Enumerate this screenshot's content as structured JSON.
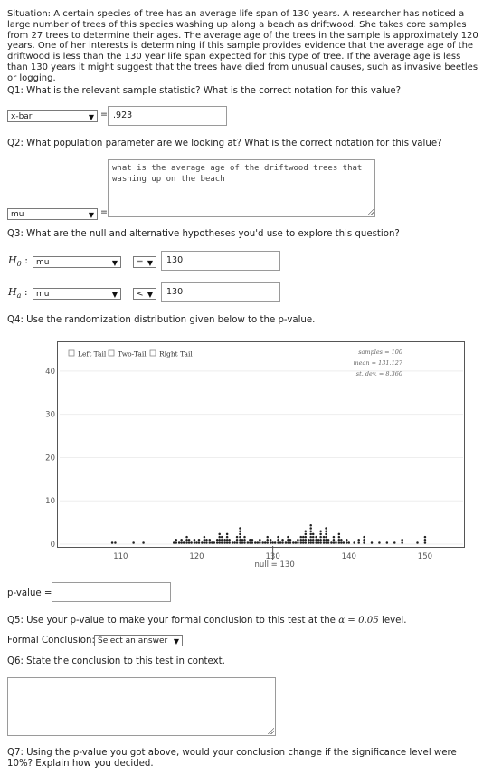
{
  "situation": "Situation: A certain species of tree has an average life span of 130 years. A researcher has noticed a large number of trees of this species washing up along a beach as driftwood. She takes core samples from 27 trees to determine their ages. The average age of the trees in the sample is approximately 120 years. One of her interests is determining if this sample provides evidence that the average age of the driftwood is less than the 130 year life span expected for this type of tree. If the average age is less than 130 years it might suggest that the trees have died from unusual causes, such as invasive beetles or logging.",
  "q1": {
    "text": "Q1: What is the relevant sample statistic? What is the correct notation for this value?",
    "notation": "x-bar",
    "equals": "=",
    "value": ".923"
  },
  "q2": {
    "text": "Q2: What population parameter are we looking at? What is the correct notation for this value?",
    "description": "what is the average age of the driftwood trees that washing up on the beach",
    "notation": "mu",
    "equals": "="
  },
  "q3": {
    "text": "Q3: What are the null and alternative hypotheses you'd use to explore this question?",
    "h0_label": "H",
    "h0_sub": "0",
    "ha_label": "H",
    "ha_sub": "a",
    "colon": ":",
    "h0_param": "mu",
    "h0_op": "=",
    "h0_value": "130",
    "ha_param": "mu",
    "ha_op": "<",
    "ha_value": "130"
  },
  "q4": {
    "text": "Q4: Use the randomization distribution given below to the p-value.",
    "pvalue_label": "p-value ="
  },
  "q5": {
    "text_pre": "Q5: Use your p-value to make your formal conclusion to this test at the ",
    "alpha": "α = 0.05",
    "text_post": " level.",
    "conclusion_label": "Formal Conclusion:",
    "conclusion_select": "Select an answer"
  },
  "q6": {
    "text": "Q6: State the conclusion to this test in context."
  },
  "q7": {
    "text": "Q7: Using the p-value you got above, would your conclusion change if the significance level were 10%? Explain how you decided."
  },
  "chart_data": {
    "type": "scatter",
    "checkboxes": [
      "Left Tail",
      "Two-Tail",
      "Right Tail"
    ],
    "stats": [
      "samples = 100",
      "mean = 131.127",
      "st. dev. = 8.360"
    ],
    "xticks": [
      "110",
      "120",
      "130",
      "140",
      "150"
    ],
    "yticks": [
      "0",
      "10",
      "20",
      "30",
      "40"
    ],
    "null_label": "null = 130",
    "xlim": [
      102,
      155
    ],
    "ylim": [
      0,
      45
    ],
    "x": [
      108.9,
      109.3,
      111.7,
      113.0,
      117.0,
      117.3,
      117.7,
      118.0,
      118.3,
      118.7,
      119.0,
      119.3,
      119.7,
      120.0,
      120.3,
      120.7,
      121.0,
      121.3,
      121.7,
      122.0,
      122.3,
      122.7,
      123.0,
      123.3,
      123.7,
      124.0,
      124.3,
      124.7,
      125.0,
      125.3,
      125.7,
      126.0,
      126.3,
      126.7,
      127.0,
      127.3,
      127.7,
      128.0,
      128.3,
      128.7,
      129.0,
      129.3,
      129.7,
      130.0,
      130.3,
      130.7,
      131.0,
      131.3,
      131.7,
      132.0,
      132.3,
      132.7,
      133.0,
      133.3,
      133.7,
      134.0,
      134.3,
      134.7,
      135.0,
      135.3,
      135.7,
      136.0,
      136.3,
      136.7,
      137.0,
      137.3,
      137.7,
      138.0,
      138.3,
      138.7,
      139.0,
      139.3,
      139.7,
      140.0,
      140.7,
      141.3,
      142.0,
      143.0,
      144.0,
      145.0,
      146.0,
      147.0,
      149.0,
      150.0
    ],
    "y": [
      1,
      1,
      1,
      1,
      1,
      2,
      1,
      2,
      1,
      3,
      2,
      1,
      2,
      1,
      2,
      1,
      3,
      2,
      2,
      1,
      1,
      2,
      4,
      3,
      2,
      4,
      2,
      1,
      1,
      3,
      6,
      2,
      3,
      1,
      2,
      2,
      1,
      1,
      2,
      1,
      1,
      3,
      2,
      1,
      1,
      3,
      1,
      2,
      1,
      3,
      2,
      1,
      1,
      2,
      3,
      3,
      5,
      2,
      7,
      4,
      3,
      2,
      5,
      3,
      6,
      2,
      1,
      3,
      1,
      4,
      2,
      1,
      2,
      1,
      1,
      2,
      3,
      1,
      1,
      1,
      1,
      2,
      1,
      3
    ]
  }
}
